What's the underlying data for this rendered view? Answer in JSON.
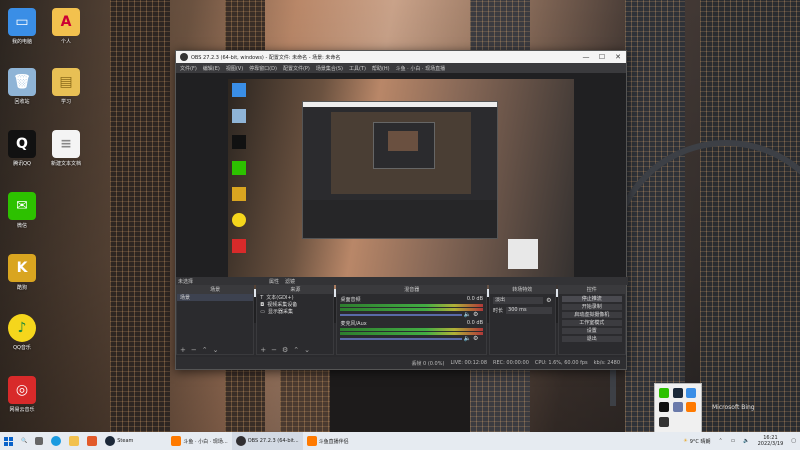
{
  "desktop": {
    "icons": [
      {
        "label": "我的电脑",
        "glyph": "▭",
        "color": "#3a8ee6"
      },
      {
        "label": "回收站",
        "glyph": "🗑",
        "color": "#8fb4d6"
      },
      {
        "label": "腾讯QQ",
        "glyph": "Q",
        "color": "#111111"
      },
      {
        "label": "微信",
        "glyph": "✉",
        "color": "#2dc100"
      },
      {
        "label": "酷狗",
        "glyph": "K",
        "color": "#d9a520"
      },
      {
        "label": "QQ音乐",
        "glyph": "♪",
        "color": "#f5d61c"
      },
      {
        "label": "网易云音乐",
        "glyph": "◎",
        "color": "#d82a2a"
      },
      {
        "label": "个人",
        "glyph": "A",
        "color": "#f2c14e"
      },
      {
        "label": "学习",
        "glyph": "▤",
        "color": "#e8c055"
      },
      {
        "label": "新建文本文档",
        "glyph": "≡",
        "color": "#f4f4f4"
      }
    ],
    "bing_label": "Microsoft Bing"
  },
  "obs": {
    "title": "OBS 27.2.3 (64-bit, windows) - 配置文件: 未命名 - 场景: 未命名",
    "window_controls": {
      "minimize": "—",
      "maximize": "☐",
      "close": "✕"
    },
    "menu": [
      "文件(F)",
      "编辑(E)",
      "视图(V)",
      "停靠窗口(D)",
      "配置文件(P)",
      "场景集合(S)",
      "工具(T)",
      "帮助(H)",
      "斗鱼 · 小白 · 现场直播"
    ],
    "dock_row": {
      "scene_label": "未选择",
      "props": "属性",
      "filters": "滤镜"
    },
    "docks": {
      "scenes": {
        "header": "场景",
        "items": [
          "场景"
        ]
      },
      "sources": {
        "header": "来源",
        "items": [
          "文本(GDI+)",
          "视频采集设备",
          "显示器采集"
        ]
      },
      "mixer": {
        "header": "混音器",
        "channels": [
          {
            "name": "桌面音频",
            "db": "0.0 dB"
          },
          {
            "name": "麦克风/Aux",
            "db": "0.0 dB"
          }
        ]
      },
      "transitions": {
        "header": "转场特效",
        "type": "淡出",
        "duration_label": "时长",
        "duration": "300 ms"
      },
      "controls": {
        "header": "控件",
        "buttons": [
          "停止推流",
          "开始录制",
          "启动虚拟摄像机",
          "工作室模式",
          "设置",
          "退出"
        ]
      }
    },
    "status": {
      "dropped": "丢帧 0 (0.0%)",
      "live": "LIVE: 00:12:08",
      "rec": "REC: 00:00:00",
      "cpu": "CPU: 1.6%, 60.00 fps",
      "kbps": "kb/s: 2480"
    }
  },
  "taskbar": {
    "search": "🔍",
    "items": [
      {
        "label": "Steam",
        "color": "#1b2838"
      },
      {
        "label": "斗鱼 · 小白 · 现场...",
        "color": "#ff7a00"
      },
      {
        "label": "OBS 27.2.3 (64-bit...",
        "color": "#302e31"
      },
      {
        "label": "斗鱼直播伴侣",
        "color": "#ff7a00"
      }
    ],
    "weather": "9°C 晴朗",
    "time": "16:21",
    "date": "2022/3/19"
  }
}
